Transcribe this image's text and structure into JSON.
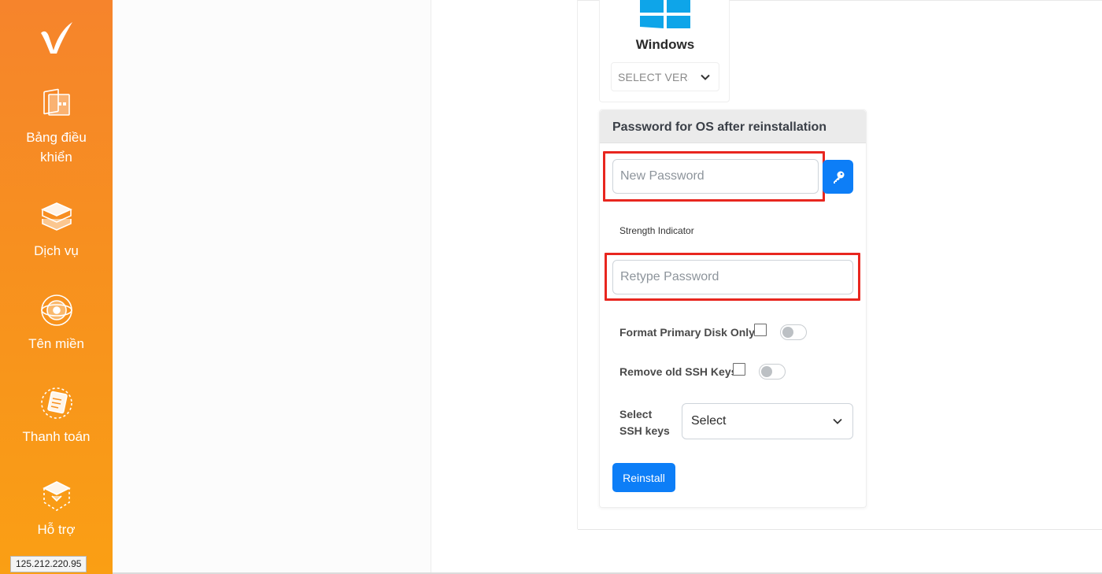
{
  "sidebar": {
    "items": [
      {
        "label": "Bảng điều khiển",
        "icon": "dashboard-icon"
      },
      {
        "label": "Dịch vụ",
        "icon": "services-icon"
      },
      {
        "label": "Tên miền",
        "icon": "domain-icon"
      },
      {
        "label": "Thanh toán",
        "icon": "billing-icon"
      },
      {
        "label": "Hỗ trợ",
        "icon": "support-icon"
      }
    ],
    "logo_icon": "check-logo-icon"
  },
  "status": {
    "ip": "125.212.220.95"
  },
  "os_card": {
    "name": "Windows",
    "version_placeholder": "SELECT VERSION",
    "icon": "windows-logo-icon"
  },
  "password_card": {
    "title": "Password for OS after reinstallation",
    "new_password_placeholder": "New Password",
    "generate_icon": "key-icon",
    "strength_label": "Strength Indicator",
    "retype_placeholder": "Retype Password",
    "format_disk_label": "Format Primary Disk Only",
    "remove_ssh_label": "Remove old SSH Keys",
    "ssh_keys_label": "Select SSH keys",
    "ssh_keys_value": "Select",
    "reinstall_label": "Reinstall"
  },
  "colors": {
    "sidebar": "#f7901f",
    "primary": "#0d7ef7",
    "highlight": "#e8261f",
    "windows": "#0ea5e9"
  }
}
